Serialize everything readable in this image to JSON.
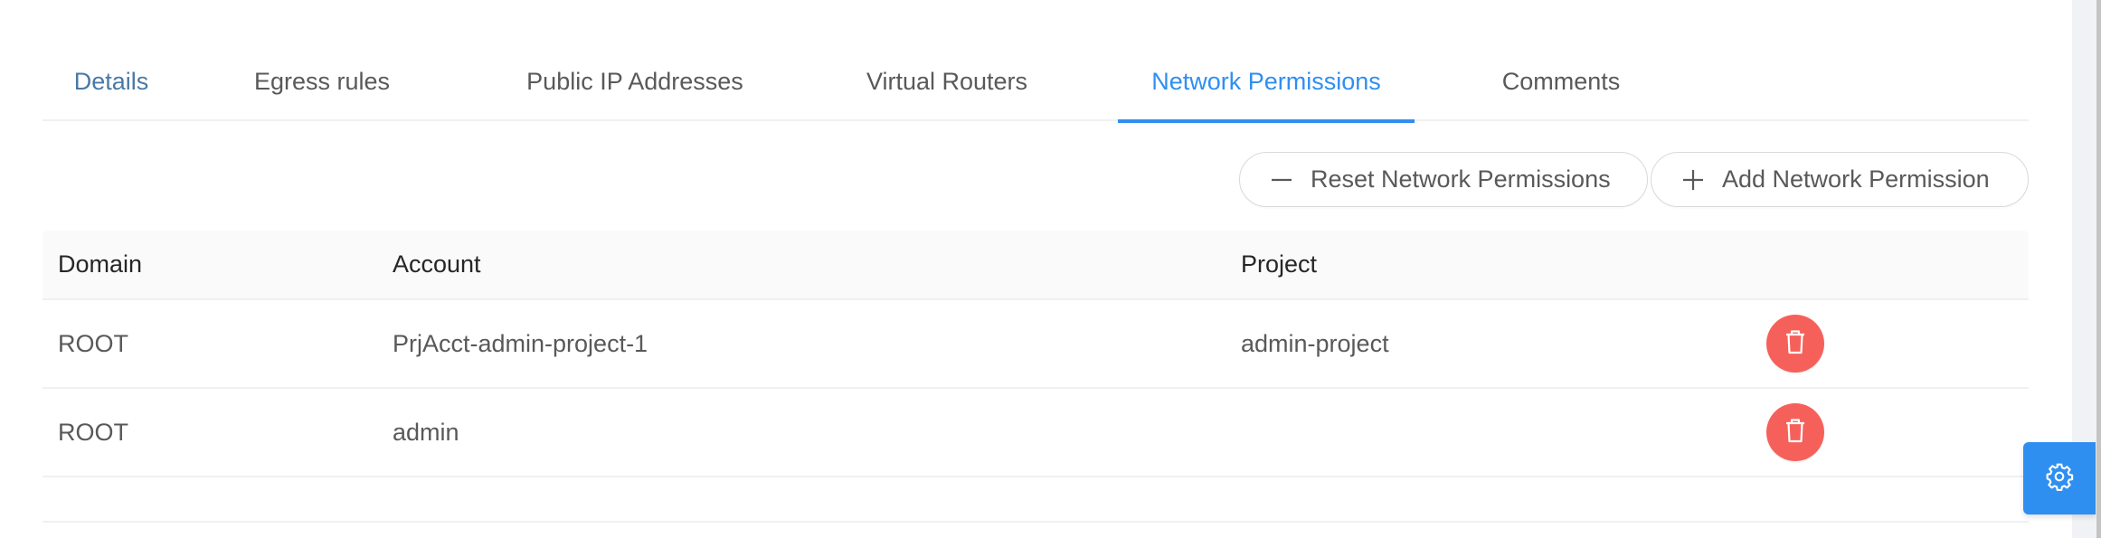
{
  "tabs": [
    {
      "label": "Details",
      "state": "hover"
    },
    {
      "label": "Egress rules",
      "state": "normal"
    },
    {
      "label": "Public IP Addresses",
      "state": "normal"
    },
    {
      "label": "Virtual Routers",
      "state": "normal"
    },
    {
      "label": "Network Permissions",
      "state": "active"
    },
    {
      "label": "Comments",
      "state": "normal"
    }
  ],
  "toolbar": {
    "reset_label": "Reset Network Permissions",
    "reset_icon": "minus-icon",
    "add_label": "Add Network Permission",
    "add_icon": "plus-icon"
  },
  "table": {
    "columns": [
      "Domain",
      "Account",
      "Project",
      ""
    ],
    "rows": [
      {
        "domain": "ROOT",
        "account": "PrjAcct-admin-project-1",
        "project": "admin-project",
        "action_icon": "delete-icon"
      },
      {
        "domain": "ROOT",
        "account": "admin",
        "project": "",
        "action_icon": "delete-icon"
      }
    ]
  },
  "floating": {
    "settings_icon": "gear-icon"
  },
  "colors": {
    "accent": "#2f8ff0",
    "danger": "#f5615a",
    "tab_hover": "#4a79a5",
    "text": "#595959",
    "header_text": "#262626"
  }
}
